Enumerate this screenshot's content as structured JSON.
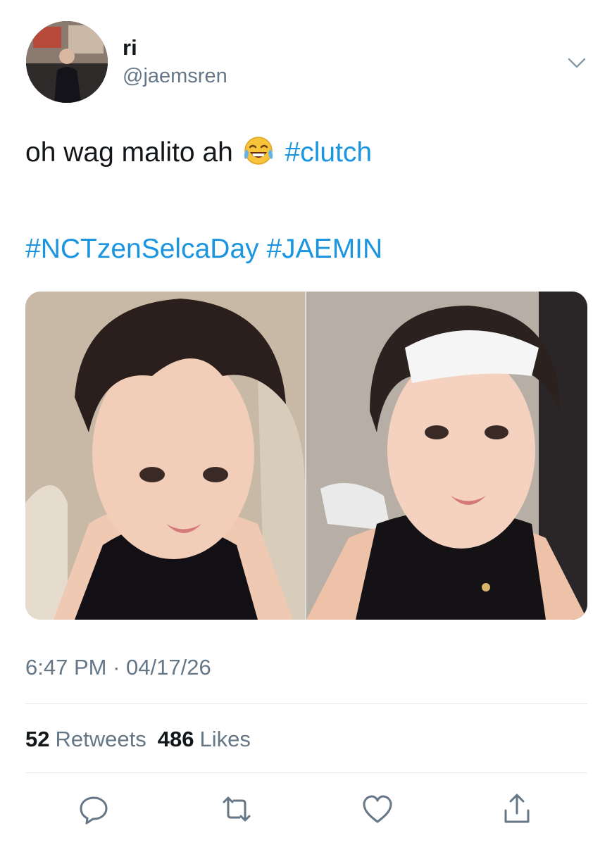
{
  "user": {
    "display_name": "ri",
    "handle": "@jaemsren",
    "avatar_icon": "profile-photo"
  },
  "tweet": {
    "text": "oh wag malito ah",
    "emoji": "😂",
    "hashtag_inline": "#clutch",
    "hashtags": [
      "#NCTzenSelcaDay",
      "#JAEMIN"
    ]
  },
  "media": {
    "count": 2
  },
  "meta": {
    "time": "6:47 PM",
    "separator": "·",
    "date": "04/17/26"
  },
  "stats": {
    "retweets_count": "52",
    "retweets_label": "Retweets",
    "likes_count": "486",
    "likes_label": "Likes"
  },
  "actions": [
    "reply-icon",
    "retweet-icon",
    "like-icon",
    "share-icon"
  ],
  "colors": {
    "link": "#1b95e0",
    "secondary_text": "#657786",
    "primary_text": "#14171a",
    "divider": "#e1e8ed",
    "icon": "#657786"
  }
}
